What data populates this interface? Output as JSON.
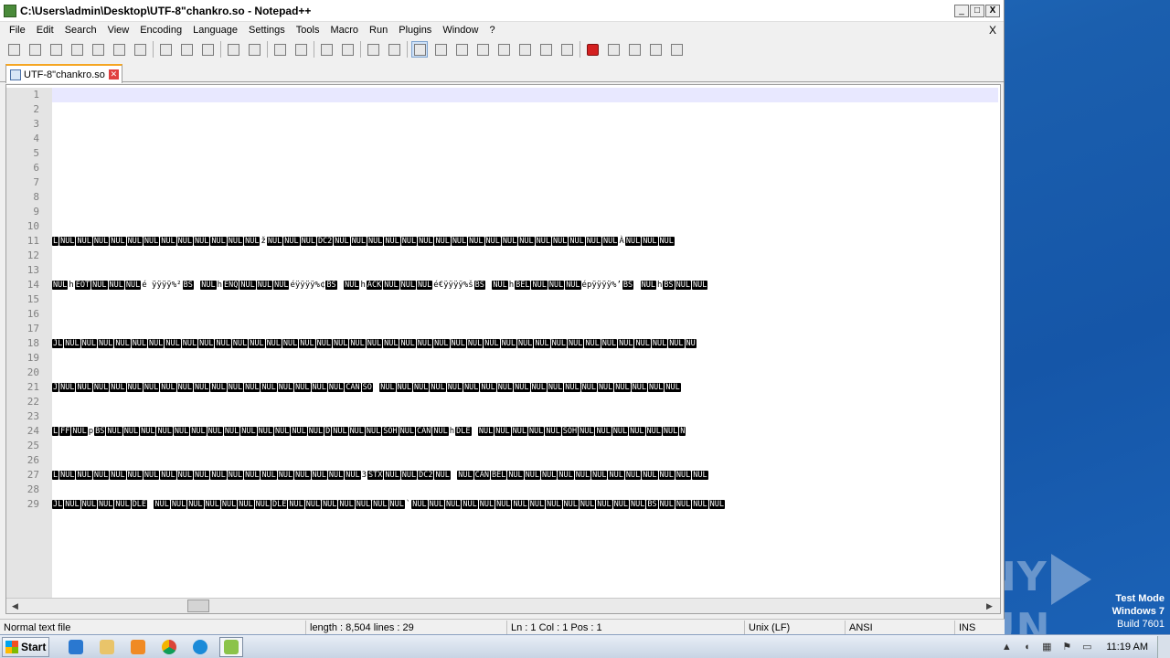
{
  "window": {
    "title": "C:\\Users\\admin\\Desktop\\UTF-8\"chankro.so - Notepad++",
    "minimize": "_",
    "maximize": "□",
    "close": "X"
  },
  "menu": [
    "File",
    "Edit",
    "Search",
    "View",
    "Encoding",
    "Language",
    "Settings",
    "Tools",
    "Macro",
    "Run",
    "Plugins",
    "Window",
    "?"
  ],
  "menu_close": "X",
  "toolbar_icons": [
    "new-file-icon",
    "open-file-icon",
    "save-icon",
    "save-all-icon",
    "close-icon",
    "close-all-icon",
    "print-icon",
    "cut-icon",
    "copy-icon",
    "paste-icon",
    "undo-icon",
    "redo-icon",
    "find-icon",
    "replace-icon",
    "zoom-in-icon",
    "zoom-out-icon",
    "sync-v-icon",
    "sync-h-icon",
    "wrap-icon",
    "all-chars-icon",
    "indent-guide-icon",
    "udl-icon",
    "doc-map-icon",
    "function-list-icon",
    "folder-workspace-icon",
    "monitor-icon",
    "record-macro-icon",
    "stop-macro-icon",
    "play-macro-icon",
    "run-macro-multiple-icon",
    "save-macro-icon"
  ],
  "tab": {
    "label": "UTF-8\"chankro.so",
    "close": "✕"
  },
  "line_numbers": [
    "1",
    "2",
    "3",
    "4",
    "5",
    "6",
    "7",
    "8",
    "9",
    "10",
    "11",
    "12",
    "13",
    "14",
    "15",
    "16",
    "17",
    "18",
    "19",
    "20",
    "21",
    "22",
    "23",
    "24",
    "25",
    "26",
    "27",
    "28",
    "29"
  ],
  "lines": {
    "l11": [
      {
        "t": "ctl",
        "v": "L"
      },
      {
        "t": "ctl",
        "v": "NUL"
      },
      {
        "t": "ctl",
        "v": "NUL"
      },
      {
        "t": "ctl",
        "v": "NUL"
      },
      {
        "t": "ctl",
        "v": "NUL"
      },
      {
        "t": "ctl",
        "v": "NUL"
      },
      {
        "t": "ctl",
        "v": "NUL"
      },
      {
        "t": "ctl",
        "v": "NUL"
      },
      {
        "t": "ctl",
        "v": "NUL"
      },
      {
        "t": "ctl",
        "v": "NUL"
      },
      {
        "t": "ctl",
        "v": "NUL"
      },
      {
        "t": "ctl",
        "v": "NUL"
      },
      {
        "t": "ctl",
        "v": "NUL"
      },
      {
        "t": "ch",
        "v": "ž"
      },
      {
        "t": "ctl",
        "v": "NUL"
      },
      {
        "t": "ctl",
        "v": "NUL"
      },
      {
        "t": "ctl",
        "v": "NUL"
      },
      {
        "t": "ctl",
        "v": "DC2"
      },
      {
        "t": "ctl",
        "v": "NUL"
      },
      {
        "t": "ctl",
        "v": "NUL"
      },
      {
        "t": "ctl",
        "v": "NUL"
      },
      {
        "t": "ctl",
        "v": "NUL"
      },
      {
        "t": "ctl",
        "v": "NUL"
      },
      {
        "t": "ctl",
        "v": "NUL"
      },
      {
        "t": "ctl",
        "v": "NUL"
      },
      {
        "t": "ctl",
        "v": "NUL"
      },
      {
        "t": "ctl",
        "v": "NUL"
      },
      {
        "t": "ctl",
        "v": "NUL"
      },
      {
        "t": "ctl",
        "v": "NUL"
      },
      {
        "t": "ctl",
        "v": "NUL"
      },
      {
        "t": "ctl",
        "v": "NUL"
      },
      {
        "t": "ctl",
        "v": "NUL"
      },
      {
        "t": "ctl",
        "v": "NUL"
      },
      {
        "t": "ctl",
        "v": "NUL"
      },
      {
        "t": "ctl",
        "v": "NUL"
      },
      {
        "t": "ch",
        "v": "À"
      },
      {
        "t": "ctl",
        "v": "NUL"
      },
      {
        "t": "ctl",
        "v": "NUL"
      },
      {
        "t": "ctl",
        "v": "NUL"
      }
    ],
    "l14": [
      {
        "t": "ctl",
        "v": "NUL"
      },
      {
        "t": "ch",
        "v": "h"
      },
      {
        "t": "ctl",
        "v": "EOT"
      },
      {
        "t": "ctl",
        "v": "NUL"
      },
      {
        "t": "ctl",
        "v": "NUL"
      },
      {
        "t": "ctl",
        "v": "NUL"
      },
      {
        "t": "ch",
        "v": "é  ÿÿÿÿ%²"
      },
      {
        "t": "ctl",
        "v": "BS"
      },
      {
        "t": "ch",
        "v": " "
      },
      {
        "t": "ctl",
        "v": "NUL"
      },
      {
        "t": "ch",
        "v": "h"
      },
      {
        "t": "ctl",
        "v": "ENQ"
      },
      {
        "t": "ctl",
        "v": "NUL"
      },
      {
        "t": "ctl",
        "v": "NUL"
      },
      {
        "t": "ctl",
        "v": "NUL"
      },
      {
        "t": "ch",
        "v": "éÿÿÿÿ%¢"
      },
      {
        "t": "ctl",
        "v": "BS"
      },
      {
        "t": "ch",
        "v": " "
      },
      {
        "t": "ctl",
        "v": "NUL"
      },
      {
        "t": "ch",
        "v": "h"
      },
      {
        "t": "ctl",
        "v": "ACK"
      },
      {
        "t": "ctl",
        "v": "NUL"
      },
      {
        "t": "ctl",
        "v": "NUL"
      },
      {
        "t": "ctl",
        "v": "NUL"
      },
      {
        "t": "ch",
        "v": "é€ÿÿÿÿ%š"
      },
      {
        "t": "ctl",
        "v": "BS"
      },
      {
        "t": "ch",
        "v": " "
      },
      {
        "t": "ctl",
        "v": "NUL"
      },
      {
        "t": "ch",
        "v": "h"
      },
      {
        "t": "ctl",
        "v": "BEL"
      },
      {
        "t": "ctl",
        "v": "NUL"
      },
      {
        "t": "ctl",
        "v": "NUL"
      },
      {
        "t": "ctl",
        "v": "NUL"
      },
      {
        "t": "ch",
        "v": "épÿÿÿÿ%’"
      },
      {
        "t": "ctl",
        "v": "BS"
      },
      {
        "t": "ch",
        "v": " "
      },
      {
        "t": "ctl",
        "v": "NUL"
      },
      {
        "t": "ch",
        "v": "h"
      },
      {
        "t": "ctl",
        "v": "BS"
      },
      {
        "t": "ctl",
        "v": "NUL"
      },
      {
        "t": "ctl",
        "v": "NUL"
      }
    ],
    "l18": [
      {
        "t": "ctl",
        "v": "JL"
      },
      {
        "t": "ctl",
        "v": "NUL"
      },
      {
        "t": "ctl",
        "v": "NUL"
      },
      {
        "t": "ctl",
        "v": "NUL"
      },
      {
        "t": "ctl",
        "v": "NUL"
      },
      {
        "t": "ctl",
        "v": "NUL"
      },
      {
        "t": "ctl",
        "v": "NUL"
      },
      {
        "t": "ctl",
        "v": "NUL"
      },
      {
        "t": "ctl",
        "v": "NUL"
      },
      {
        "t": "ctl",
        "v": "NUL"
      },
      {
        "t": "ctl",
        "v": "NUL"
      },
      {
        "t": "ctl",
        "v": "NUL"
      },
      {
        "t": "ctl",
        "v": "NUL"
      },
      {
        "t": "ctl",
        "v": "NUL"
      },
      {
        "t": "ctl",
        "v": "NUL"
      },
      {
        "t": "ctl",
        "v": "NUL"
      },
      {
        "t": "ctl",
        "v": "NUL"
      },
      {
        "t": "ctl",
        "v": "NUL"
      },
      {
        "t": "ctl",
        "v": "NUL"
      },
      {
        "t": "ctl",
        "v": "NUL"
      },
      {
        "t": "ctl",
        "v": "NUL"
      },
      {
        "t": "ctl",
        "v": "NUL"
      },
      {
        "t": "ctl",
        "v": "NUL"
      },
      {
        "t": "ctl",
        "v": "NUL"
      },
      {
        "t": "ctl",
        "v": "NUL"
      },
      {
        "t": "ctl",
        "v": "NUL"
      },
      {
        "t": "ctl",
        "v": "NUL"
      },
      {
        "t": "ctl",
        "v": "NUL"
      },
      {
        "t": "ctl",
        "v": "NUL"
      },
      {
        "t": "ctl",
        "v": "NUL"
      },
      {
        "t": "ctl",
        "v": "NUL"
      },
      {
        "t": "ctl",
        "v": "NUL"
      },
      {
        "t": "ctl",
        "v": "NUL"
      },
      {
        "t": "ctl",
        "v": "NUL"
      },
      {
        "t": "ctl",
        "v": "NUL"
      },
      {
        "t": "ctl",
        "v": "NUL"
      },
      {
        "t": "ctl",
        "v": "NUL"
      },
      {
        "t": "ctl",
        "v": "NUL"
      },
      {
        "t": "ctl",
        "v": "NU"
      }
    ],
    "l21": [
      {
        "t": "ctl",
        "v": "J"
      },
      {
        "t": "ctl",
        "v": "NUL"
      },
      {
        "t": "ctl",
        "v": "NUL"
      },
      {
        "t": "ctl",
        "v": "NUL"
      },
      {
        "t": "ctl",
        "v": "NUL"
      },
      {
        "t": "ctl",
        "v": "NUL"
      },
      {
        "t": "ctl",
        "v": "NUL"
      },
      {
        "t": "ctl",
        "v": "NUL"
      },
      {
        "t": "ctl",
        "v": "NUL"
      },
      {
        "t": "ctl",
        "v": "NUL"
      },
      {
        "t": "ctl",
        "v": "NUL"
      },
      {
        "t": "ctl",
        "v": "NUL"
      },
      {
        "t": "ctl",
        "v": "NUL"
      },
      {
        "t": "ctl",
        "v": "NUL"
      },
      {
        "t": "ctl",
        "v": "NUL"
      },
      {
        "t": "ctl",
        "v": "NUL"
      },
      {
        "t": "ctl",
        "v": "NUL"
      },
      {
        "t": "ctl",
        "v": "NUL"
      },
      {
        "t": "ctl",
        "v": "CAN"
      },
      {
        "t": "ctl",
        "v": "SO"
      },
      {
        "t": "ch",
        "v": " "
      },
      {
        "t": "ctl",
        "v": "NUL"
      },
      {
        "t": "ctl",
        "v": "NUL"
      },
      {
        "t": "ctl",
        "v": "NUL"
      },
      {
        "t": "ctl",
        "v": "NUL"
      },
      {
        "t": "ctl",
        "v": "NUL"
      },
      {
        "t": "ctl",
        "v": "NUL"
      },
      {
        "t": "ctl",
        "v": "NUL"
      },
      {
        "t": "ctl",
        "v": "NUL"
      },
      {
        "t": "ctl",
        "v": "NUL"
      },
      {
        "t": "ctl",
        "v": "NUL"
      },
      {
        "t": "ctl",
        "v": "NUL"
      },
      {
        "t": "ctl",
        "v": "NUL"
      },
      {
        "t": "ctl",
        "v": "NUL"
      },
      {
        "t": "ctl",
        "v": "NUL"
      },
      {
        "t": "ctl",
        "v": "NUL"
      },
      {
        "t": "ctl",
        "v": "NUL"
      },
      {
        "t": "ctl",
        "v": "NUL"
      },
      {
        "t": "ctl",
        "v": "NUL"
      }
    ],
    "l24": [
      {
        "t": "ctl",
        "v": "L"
      },
      {
        "t": "ctl",
        "v": "FF"
      },
      {
        "t": "ctl",
        "v": "NUL"
      },
      {
        "t": "ch",
        "v": "p"
      },
      {
        "t": "ctl",
        "v": "BS"
      },
      {
        "t": "ctl",
        "v": "NUL"
      },
      {
        "t": "ctl",
        "v": "NUL"
      },
      {
        "t": "ctl",
        "v": "NUL"
      },
      {
        "t": "ctl",
        "v": "NUL"
      },
      {
        "t": "ctl",
        "v": "NUL"
      },
      {
        "t": "ctl",
        "v": "NUL"
      },
      {
        "t": "ctl",
        "v": "NUL"
      },
      {
        "t": "ctl",
        "v": "NUL"
      },
      {
        "t": "ctl",
        "v": "NUL"
      },
      {
        "t": "ctl",
        "v": "NUL"
      },
      {
        "t": "ctl",
        "v": "NUL"
      },
      {
        "t": "ctl",
        "v": "NUL"
      },
      {
        "t": "ctl",
        "v": "NUL"
      },
      {
        "t": "ctl",
        "v": "D"
      },
      {
        "t": "ctl",
        "v": "NUL"
      },
      {
        "t": "ctl",
        "v": "NUL"
      },
      {
        "t": "ctl",
        "v": "NUL"
      },
      {
        "t": "ctl",
        "v": "SOH"
      },
      {
        "t": "ctl",
        "v": "NUL"
      },
      {
        "t": "ctl",
        "v": "CAN"
      },
      {
        "t": "ctl",
        "v": "NUL"
      },
      {
        "t": "ch",
        "v": "h"
      },
      {
        "t": "ctl",
        "v": "DLE"
      },
      {
        "t": "ch",
        "v": " "
      },
      {
        "t": "ctl",
        "v": "NUL"
      },
      {
        "t": "ctl",
        "v": "NUL"
      },
      {
        "t": "ctl",
        "v": "NUL"
      },
      {
        "t": "ctl",
        "v": "NUL"
      },
      {
        "t": "ctl",
        "v": "NUL"
      },
      {
        "t": "ctl",
        "v": "SOH"
      },
      {
        "t": "ctl",
        "v": "NUL"
      },
      {
        "t": "ctl",
        "v": "NUL"
      },
      {
        "t": "ctl",
        "v": "NUL"
      },
      {
        "t": "ctl",
        "v": "NUL"
      },
      {
        "t": "ctl",
        "v": "NUL"
      },
      {
        "t": "ctl",
        "v": "NUL"
      },
      {
        "t": "ctl",
        "v": "N"
      }
    ],
    "l27": [
      {
        "t": "ctl",
        "v": "L"
      },
      {
        "t": "ctl",
        "v": "NUL"
      },
      {
        "t": "ctl",
        "v": "NUL"
      },
      {
        "t": "ctl",
        "v": "NUL"
      },
      {
        "t": "ctl",
        "v": "NUL"
      },
      {
        "t": "ctl",
        "v": "NUL"
      },
      {
        "t": "ctl",
        "v": "NUL"
      },
      {
        "t": "ctl",
        "v": "NUL"
      },
      {
        "t": "ctl",
        "v": "NUL"
      },
      {
        "t": "ctl",
        "v": "NUL"
      },
      {
        "t": "ctl",
        "v": "NUL"
      },
      {
        "t": "ctl",
        "v": "NUL"
      },
      {
        "t": "ctl",
        "v": "NUL"
      },
      {
        "t": "ctl",
        "v": "NUL"
      },
      {
        "t": "ctl",
        "v": "NUL"
      },
      {
        "t": "ctl",
        "v": "NUL"
      },
      {
        "t": "ctl",
        "v": "NUL"
      },
      {
        "t": "ctl",
        "v": "NUL"
      },
      {
        "t": "ctl",
        "v": "NUL"
      },
      {
        "t": "ch",
        "v": "3"
      },
      {
        "t": "ctl",
        "v": "STX"
      },
      {
        "t": "ctl",
        "v": "NUL"
      },
      {
        "t": "ctl",
        "v": "NUL"
      },
      {
        "t": "ctl",
        "v": "DC2"
      },
      {
        "t": "ctl",
        "v": "NUL"
      },
      {
        "t": "ch",
        "v": "   "
      },
      {
        "t": "ctl",
        "v": "NUL"
      },
      {
        "t": "ctl",
        "v": "CAN"
      },
      {
        "t": "ctl",
        "v": "BEL"
      },
      {
        "t": "ctl",
        "v": "NUL"
      },
      {
        "t": "ctl",
        "v": "NUL"
      },
      {
        "t": "ctl",
        "v": "NUL"
      },
      {
        "t": "ctl",
        "v": "NUL"
      },
      {
        "t": "ctl",
        "v": "NUL"
      },
      {
        "t": "ctl",
        "v": "NUL"
      },
      {
        "t": "ctl",
        "v": "NUL"
      },
      {
        "t": "ctl",
        "v": "NUL"
      },
      {
        "t": "ctl",
        "v": "NUL"
      },
      {
        "t": "ctl",
        "v": "NUL"
      },
      {
        "t": "ctl",
        "v": "NUL"
      },
      {
        "t": "ctl",
        "v": "NUL"
      }
    ],
    "l29": [
      {
        "t": "ctl",
        "v": "JL"
      },
      {
        "t": "ctl",
        "v": "NUL"
      },
      {
        "t": "ctl",
        "v": "NUL"
      },
      {
        "t": "ctl",
        "v": "NUL"
      },
      {
        "t": "ctl",
        "v": "NUL"
      },
      {
        "t": "ctl",
        "v": "DLE"
      },
      {
        "t": "ch",
        "v": " "
      },
      {
        "t": "ctl",
        "v": "NUL"
      },
      {
        "t": "ctl",
        "v": "NUL"
      },
      {
        "t": "ctl",
        "v": "NUL"
      },
      {
        "t": "ctl",
        "v": "NUL"
      },
      {
        "t": "ctl",
        "v": "NUL"
      },
      {
        "t": "ctl",
        "v": "NUL"
      },
      {
        "t": "ctl",
        "v": "NUL"
      },
      {
        "t": "ctl",
        "v": "DLE"
      },
      {
        "t": "ctl",
        "v": "NUL"
      },
      {
        "t": "ctl",
        "v": "NUL"
      },
      {
        "t": "ctl",
        "v": "NUL"
      },
      {
        "t": "ctl",
        "v": "NUL"
      },
      {
        "t": "ctl",
        "v": "NUL"
      },
      {
        "t": "ctl",
        "v": "NUL"
      },
      {
        "t": "ctl",
        "v": "NUL"
      },
      {
        "t": "ch",
        "v": "`"
      },
      {
        "t": "ctl",
        "v": "NUL"
      },
      {
        "t": "ctl",
        "v": "NUL"
      },
      {
        "t": "ctl",
        "v": "NUL"
      },
      {
        "t": "ctl",
        "v": "NUL"
      },
      {
        "t": "ctl",
        "v": "NUL"
      },
      {
        "t": "ctl",
        "v": "NUL"
      },
      {
        "t": "ctl",
        "v": "NUL"
      },
      {
        "t": "ctl",
        "v": "NUL"
      },
      {
        "t": "ctl",
        "v": "NUL"
      },
      {
        "t": "ctl",
        "v": "NUL"
      },
      {
        "t": "ctl",
        "v": "NUL"
      },
      {
        "t": "ctl",
        "v": "NUL"
      },
      {
        "t": "ctl",
        "v": "NUL"
      },
      {
        "t": "ctl",
        "v": "NUL"
      },
      {
        "t": "ctl",
        "v": "BS"
      },
      {
        "t": "ctl",
        "v": "NUL"
      },
      {
        "t": "ctl",
        "v": "NUL"
      },
      {
        "t": "ctl",
        "v": "NUL"
      },
      {
        "t": "ctl",
        "v": "NUL"
      }
    ]
  },
  "status": {
    "file_type": "Normal text file",
    "length_lines": "length : 8,504    lines : 29",
    "position": "Ln : 1    Col : 1    Pos : 1",
    "eol": "Unix (LF)",
    "encoding": "ANSI",
    "mode": "INS"
  },
  "taskbar": {
    "start": "Start",
    "apps": [
      "ie-icon",
      "explorer-icon",
      "media-player-icon",
      "chrome-icon",
      "edge-icon",
      "notepadpp-icon"
    ],
    "clock": "11:19 AM"
  },
  "desktop": {
    "watermark_left": "ANY",
    "watermark_right": "RUN",
    "test_mode": "Test Mode",
    "os": "Windows 7",
    "build": "Build 7601"
  },
  "colors": {
    "control_char_bg": "#000000",
    "control_char_fg": "#ffffff",
    "current_line": "#e8e8ff",
    "tab_accent": "#f5a623"
  }
}
